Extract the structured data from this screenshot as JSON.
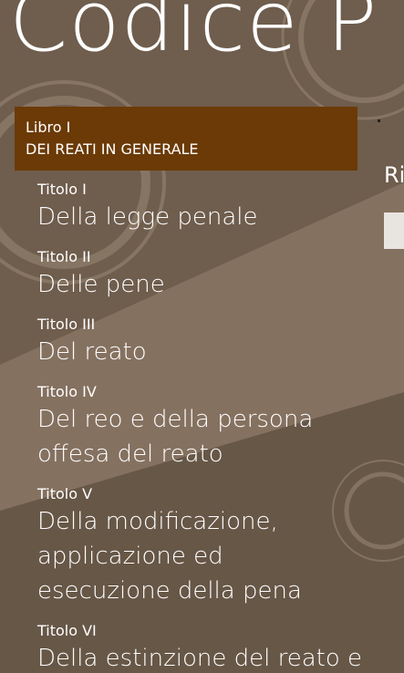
{
  "app": {
    "title": "Codice P"
  },
  "book": {
    "label": "Libro  I",
    "name": "DEI REATI IN GENERALE"
  },
  "titles": [
    {
      "label": "Titolo  I",
      "name": "Della legge penale"
    },
    {
      "label": "Titolo  II",
      "name": "Delle pene"
    },
    {
      "label": "Titolo  III",
      "name": "Del reato"
    },
    {
      "label": "Titolo  IV",
      "name": "Del reo e della persona\noffesa del reato"
    },
    {
      "label": "Titolo  V",
      "name": "Della modificazione,\napplicazione ed\nesecuzione della pena"
    },
    {
      "label": "Titolo  VI",
      "name": "Della estinzione del reato e"
    }
  ],
  "side_panel": {
    "peek_text": "Ri"
  },
  "colors": {
    "background": "#7e6b5a",
    "background_dark": "#5f5144",
    "book_header": "#6b3a06",
    "text": "#ffffff"
  }
}
